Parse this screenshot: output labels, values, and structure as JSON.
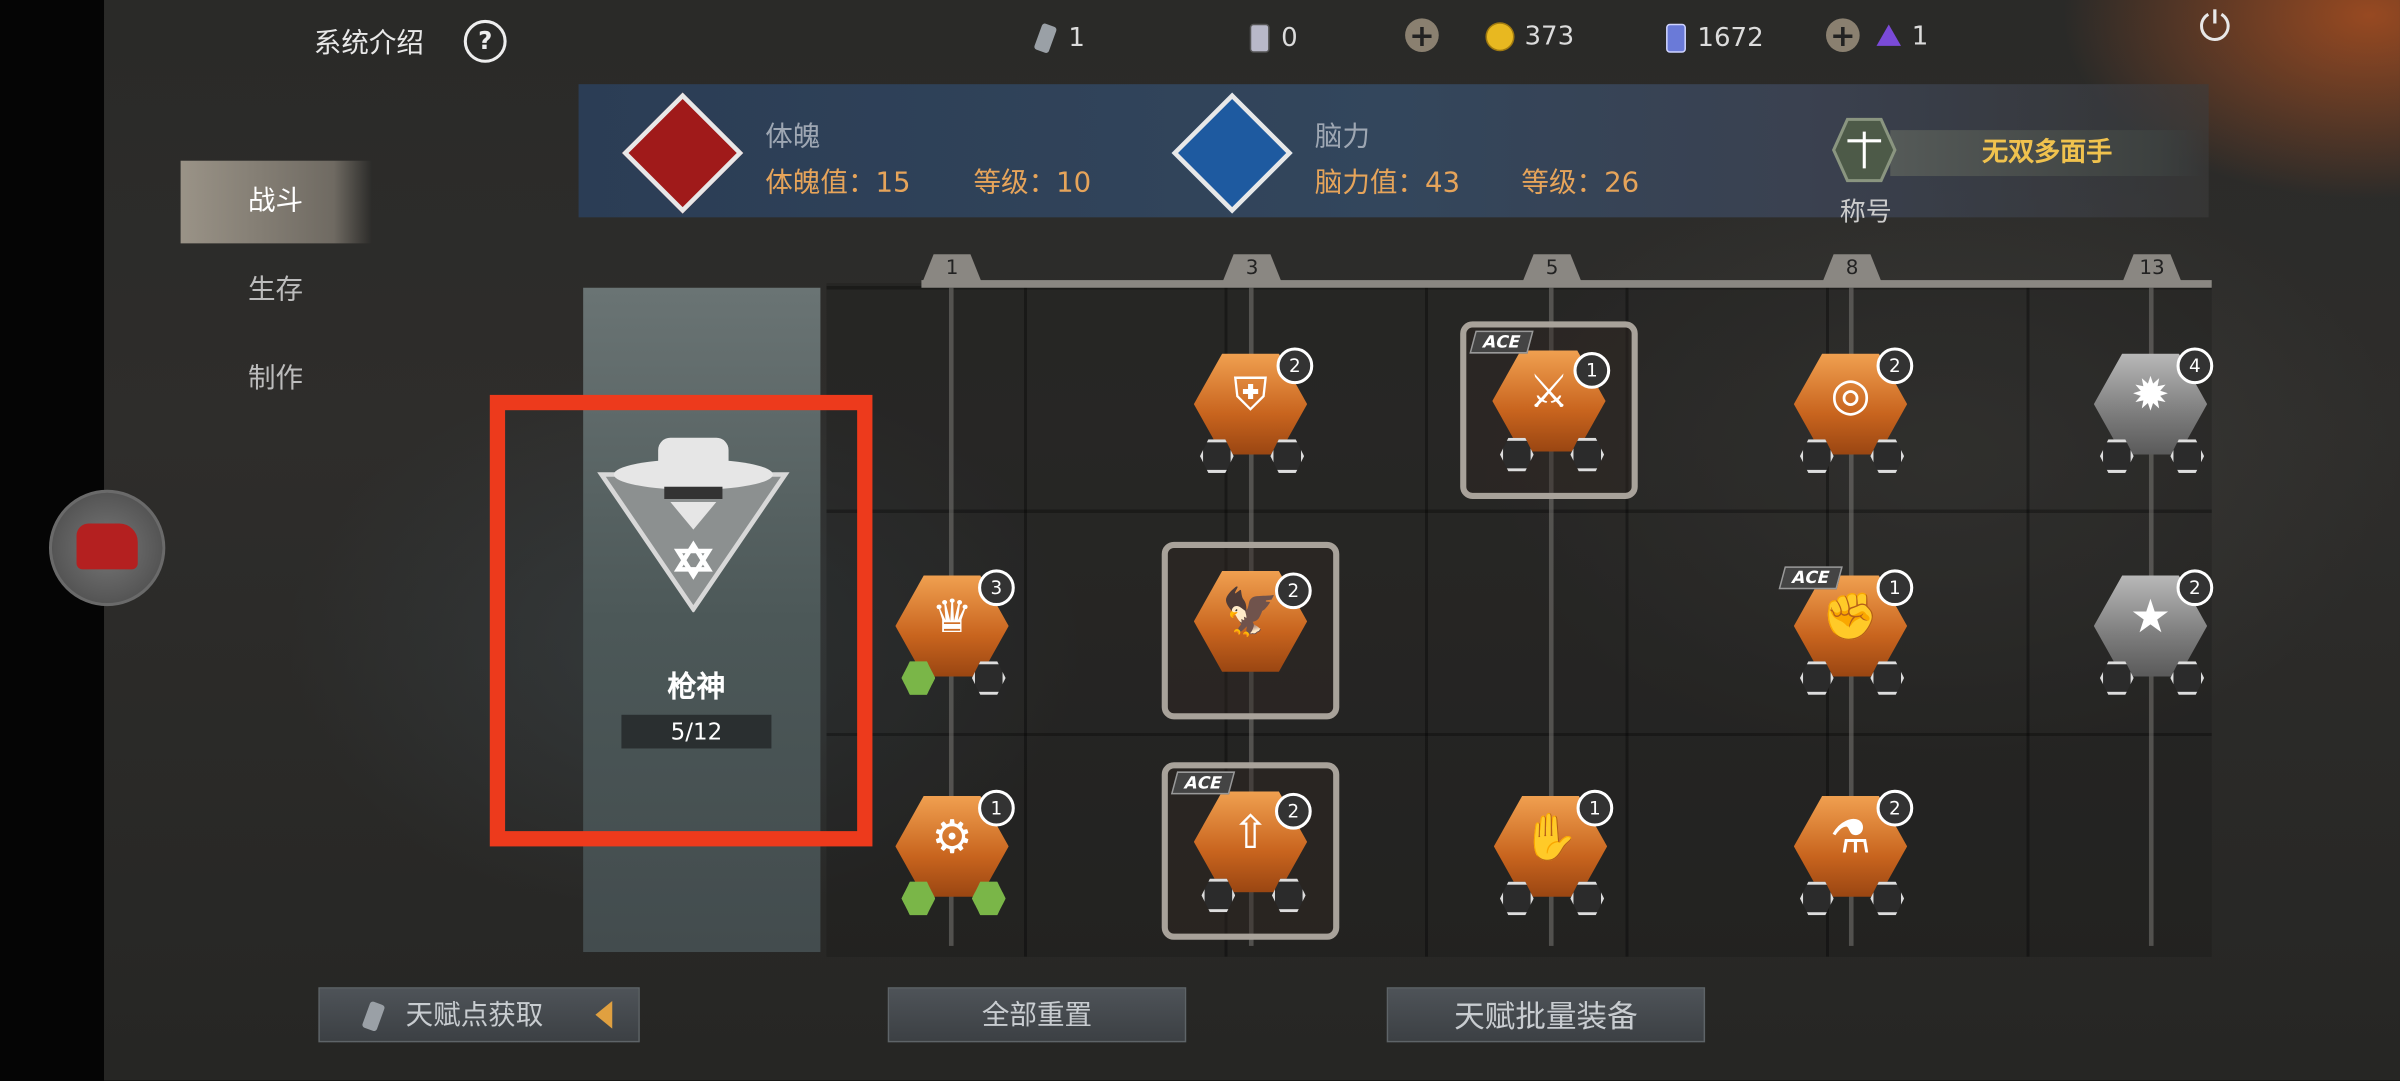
{
  "topbar": {
    "system_intro": "系统介绍",
    "help_icon": "?",
    "resources": [
      {
        "icon": "talent-token-icon",
        "value": "1"
      },
      {
        "icon": "card-icon",
        "value": "0"
      },
      {
        "icon": "gold-coin-icon",
        "value": "373"
      },
      {
        "icon": "crystal-card-icon",
        "value": "1672"
      },
      {
        "icon": "purple-gem-icon",
        "value": "1"
      }
    ]
  },
  "menu": {
    "items": [
      {
        "label": "战斗",
        "active": true
      },
      {
        "label": "生存",
        "active": false
      },
      {
        "label": "制作",
        "active": false
      }
    ]
  },
  "stats": {
    "physique": {
      "title": "体魄",
      "value_label": "体魄值：15",
      "level_label": "等级：10"
    },
    "mind": {
      "title": "脑力",
      "value_label": "脑力值：43",
      "level_label": "等级：26"
    },
    "title_name": "无双多面手",
    "title_label": "称号"
  },
  "tiers": [
    "1",
    "3",
    "5",
    "8",
    "13"
  ],
  "selected": {
    "name": "枪神",
    "progress": "5/12"
  },
  "nodes": [
    {
      "id": "n1",
      "level": "2",
      "ace": false
    },
    {
      "id": "n2",
      "level": "1",
      "ace": true,
      "ace_label": "ACE"
    },
    {
      "id": "n3",
      "level": "2",
      "ace": false
    },
    {
      "id": "n4",
      "level": "4",
      "ace": false
    },
    {
      "id": "n5",
      "level": "3",
      "ace": false
    },
    {
      "id": "n6",
      "level": "2",
      "ace": false
    },
    {
      "id": "n7",
      "level": "1",
      "ace": true,
      "ace_label": "ACE"
    },
    {
      "id": "n8",
      "level": "2",
      "ace": false
    },
    {
      "id": "n9",
      "level": "1",
      "ace": false
    },
    {
      "id": "n10",
      "level": "2",
      "ace": true,
      "ace_label": "ACE"
    },
    {
      "id": "n11",
      "level": "1",
      "ace": false
    },
    {
      "id": "n12",
      "level": "2",
      "ace": false
    }
  ],
  "bottom": {
    "get_points": "天赋点获取",
    "reset_all": "全部重置",
    "batch_equip": "天赋批量装备"
  },
  "colors": {
    "accent": "#e6a45a",
    "highlight_box": "#ed3a1c",
    "title_gold": "#f0c24e"
  }
}
